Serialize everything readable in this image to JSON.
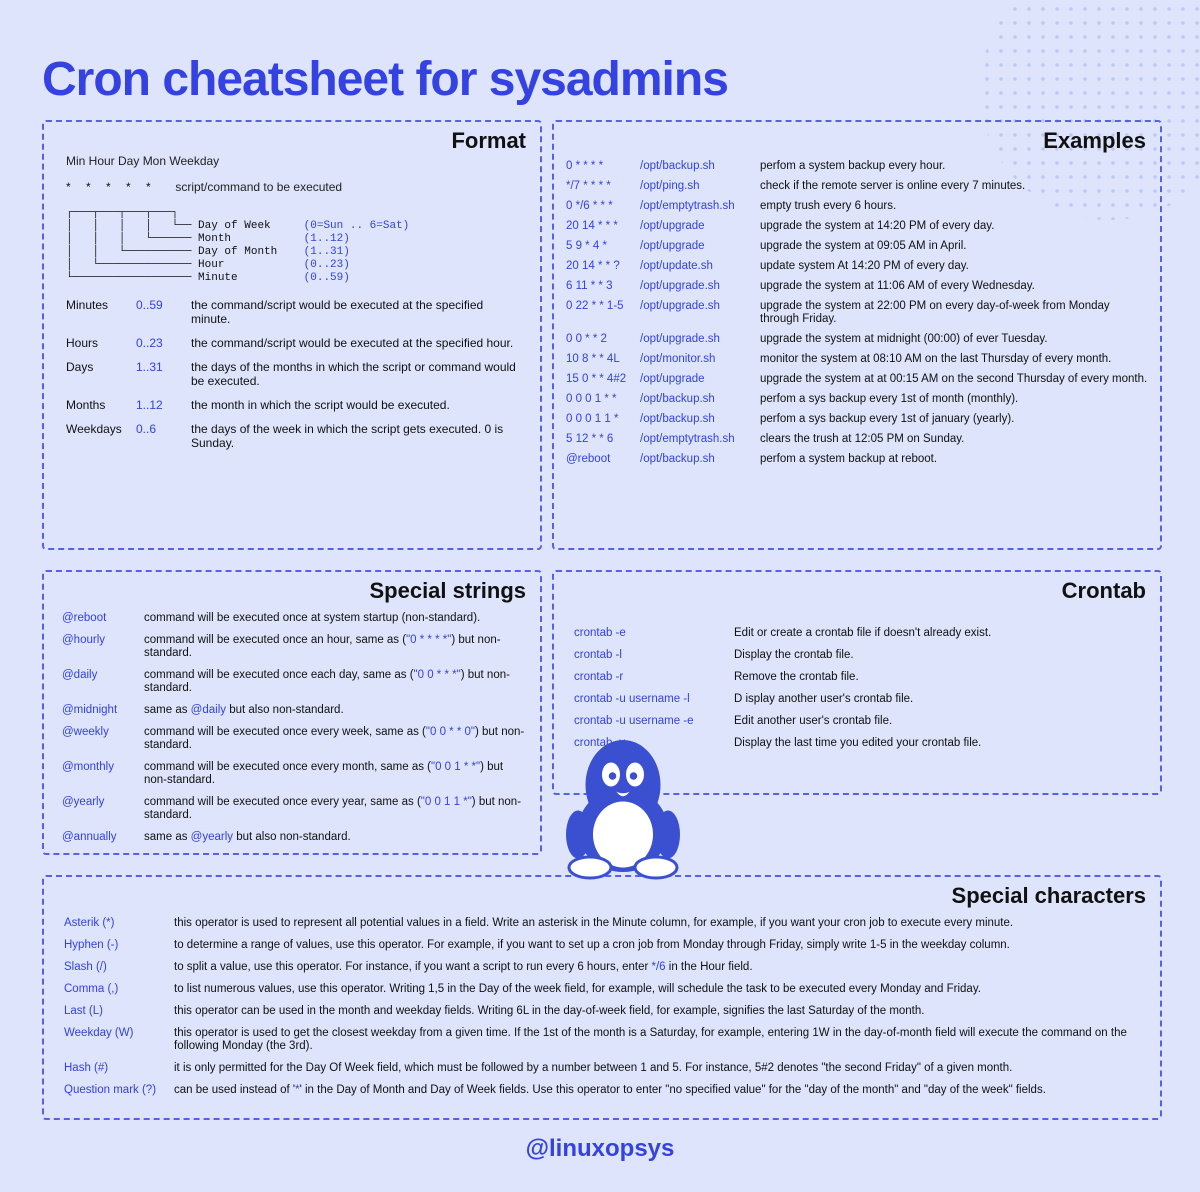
{
  "title": "Cron cheatsheet for sysadmins",
  "footer": "@linuxopsys",
  "format": {
    "heading": "Format",
    "head_labels": "Min  Hour Day  Mon  Weekday",
    "stars_label": "script/command to be executed",
    "diagram_lines": [
      {
        "pre": "┌───┬───┬───┬───┐",
        "name": "",
        "rng": ""
      },
      {
        "pre": "│   │   │   │   └── ",
        "name": "Day of Week",
        "rng": "(0=Sun .. 6=Sat)"
      },
      {
        "pre": "│   │   │   └────── ",
        "name": "Month",
        "rng": "(1..12)"
      },
      {
        "pre": "│   │   └────────── ",
        "name": "Day of Month",
        "rng": "(1..31)"
      },
      {
        "pre": "│   └────────────── ",
        "name": "Hour",
        "rng": "(0..23)"
      },
      {
        "pre": "└────────────────── ",
        "name": "Minute",
        "rng": "(0..59)"
      }
    ],
    "rows": [
      {
        "c1": "Minutes",
        "c2": "0..59",
        "c3": "the command/script would be executed at the specified minute."
      },
      {
        "c1": "Hours",
        "c2": "0..23",
        "c3": "the command/script would be executed at the specified hour."
      },
      {
        "c1": "Days",
        "c2": "1..31",
        "c3": "the days of the months in which the script or command would be executed."
      },
      {
        "c1": "Months",
        "c2": "1..12",
        "c3": "the month in which the script would  be executed."
      },
      {
        "c1": "Weekdays",
        "c2": "0..6",
        "c3": "the days of the week in which the script gets executed. 0 is Sunday."
      }
    ]
  },
  "examples": {
    "heading": "Examples",
    "rows": [
      {
        "c1": "0 * * * *",
        "c2": "/opt/backup.sh",
        "c3": "perfom a system backup every hour."
      },
      {
        "c1": "*/7 * * * *",
        "c2": "/opt/ping.sh",
        "c3": "check if the remote server is online every 7 minutes."
      },
      {
        "c1": "0 */6 * * *",
        "c2": "/opt/emptytrash.sh",
        "c3": "empty trush every 6 hours."
      },
      {
        "c1": "20 14 * * *",
        "c2": "/opt/upgrade",
        "c3": "upgrade the system at 14:20 PM of every day."
      },
      {
        "c1": "5 9 * 4 *",
        "c2": "/opt/upgrade",
        "c3": "upgrade the system at  09:05 AM in April."
      },
      {
        "c1": "20 14 * * ?",
        "c2": "/opt/update.sh",
        "c3": "update system   At 14:20 PM of every day."
      },
      {
        "c1": "6 11 * * 3",
        "c2": "/opt/upgrade.sh",
        "c3": "upgrade the system at 11:06 AM of every Wednesday."
      },
      {
        "c1": "0 22 * * 1-5",
        "c2": "/opt/upgrade.sh",
        "c3": "upgrade the system at 22:00 PM on every day-of-week from Monday through Friday."
      },
      {
        "c1": "0 0 * * 2",
        "c2": "/opt/upgrade.sh",
        "c3": "upgrade the system at midnight (00:00) of ever Tuesday."
      },
      {
        "c1": "10 8 * * 4L",
        "c2": "/opt/monitor.sh",
        "c3": "monitor the system at 08:10 AM on the last Thursday of every month."
      },
      {
        "c1": "15 0 * * 4#2",
        "c2": "/opt/upgrade",
        "c3": "upgrade the system at at 00:15 AM on the second Thursday of every month."
      },
      {
        "c1": "0 0 0 1 * *",
        "c2": "/opt/backup.sh",
        "c3": "perfom a sys backup every 1st of month (monthly)."
      },
      {
        "c1": "0 0 0 1 1 *",
        "c2": "/opt/backup.sh",
        "c3": "perfom a sys backup every 1st of january (yearly)."
      },
      {
        "c1": "5 12 * * 6",
        "c2": "/opt/emptytrash.sh",
        "c3": "clears the trush at 12:05 PM on Sunday."
      },
      {
        "c1": "@reboot",
        "c2": "/opt/backup.sh",
        "c3": "perfom a system backup at reboot."
      }
    ]
  },
  "special_strings": {
    "heading": "Special strings",
    "rows": [
      {
        "c1": "@reboot",
        "pre": "command will be executed once at system startup (non-standard).",
        "code": "",
        "post": ""
      },
      {
        "c1": "@hourly",
        "pre": "command will be executed once an hour, same as (",
        "code": "\"0 * * * *\"",
        "post": ") but non-standard."
      },
      {
        "c1": "@daily",
        "pre": "command will be executed once each day, same as (",
        "code": "\"0 0 * * *\"",
        "post": ") but non-standard."
      },
      {
        "c1": "@midnight",
        "pre": "same as ",
        "code": "@daily",
        "post": " but also non-standard."
      },
      {
        "c1": "@weekly",
        "pre": "command will be executed once every week, same as (",
        "code": "\"0 0 * * 0\"",
        "post": ") but non-standard."
      },
      {
        "c1": "@monthly",
        "pre": "command will be executed once every month, same as  (",
        "code": "\"0 0 1 * *\"",
        "post": ") but non-standard."
      },
      {
        "c1": "@yearly",
        "pre": "command will be executed once every year, same as  (",
        "code": "\"0 0 1 1 *\"",
        "post": ") but non-standard."
      },
      {
        "c1": "@annually",
        "pre": "same as ",
        "code": "@yearly",
        "post": " but also non-standard."
      }
    ]
  },
  "crontab": {
    "heading": "Crontab",
    "rows": [
      {
        "c1": "crontab -e",
        "c2": "Edit or create a crontab file if doesn't already exist."
      },
      {
        "c1": "crontab -l",
        "c2": "Display the crontab file."
      },
      {
        "c1": "crontab -r",
        "c2": "Remove the crontab file."
      },
      {
        "c1": "crontab -u username -l",
        "c2": "D isplay another user's crontab file."
      },
      {
        "c1": "crontab -u username -e",
        "c2": "Edit another user's crontab file."
      },
      {
        "c1": "crontab  -v",
        "c2": "Display the last time you edited your crontab file."
      }
    ]
  },
  "special_chars": {
    "heading": "Special characters",
    "rows": [
      {
        "c1": "Asterik (*)",
        "pre": "this operator is used to represent all potential values in a field. Write an asterisk in the Minute column, for example,  if you want your cron job to execute every minute.",
        "code": "",
        "post": ""
      },
      {
        "c1": "Hyphen (-)",
        "pre": "to determine a range of values, use this operator. For example, if you want to set up a cron job from Monday through Friday, simply write 1-5 in the weekday column.",
        "code": "",
        "post": ""
      },
      {
        "c1": "Slash (/)",
        "pre": " to split a value, use this operator. For instance, if you want a script to run every 6 hours, enter ",
        "code": "*/6",
        "post": " in the Hour field."
      },
      {
        "c1": "Comma (,)",
        "pre": "to list numerous values, use this operator. Writing 1,5 in the Day of the week field, for example, will schedule the task to be executed every Monday and Friday.",
        "code": "",
        "post": ""
      },
      {
        "c1": "Last (L)",
        "pre": "this operator can be used in the month and weekday fields. Writing 6L in the day-of-week field, for example, signifies the last Saturday of the month.",
        "code": "",
        "post": ""
      },
      {
        "c1": "Weekday (W)",
        "pre": "this operator is used to get the closest weekday from a given time. If the 1st of the month is a Saturday, for example,  entering 1W in the day-of-month field will execute the command on the following Monday (the 3rd).",
        "code": "",
        "post": ""
      },
      {
        "c1": "Hash (#)",
        "pre": "it is only permitted for the Day Of Week field, which must be followed by a number between 1 and 5. For instance, 5#2 denotes  \"the second Friday\" of a given month.",
        "code": "",
        "post": ""
      },
      {
        "c1": "Question mark (?)",
        "pre": "can be used instead of '",
        "code": "*",
        "post": "' in the Day of Month and Day of Week fields. Use this operator to enter \"no specified value\"  for the \"day of the month\" and \"day of the week\" fields."
      }
    ]
  }
}
